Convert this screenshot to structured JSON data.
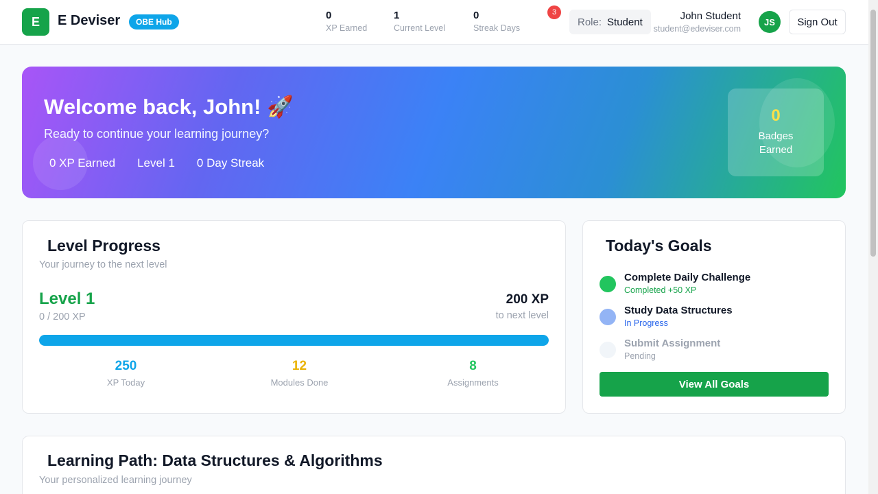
{
  "header": {
    "logo_letter": "E",
    "app_title": "E Deviser",
    "hub_badge": "OBE Hub",
    "stats": [
      {
        "value": "0",
        "label": "XP Earned"
      },
      {
        "value": "1",
        "label": "Current Level"
      },
      {
        "value": "0",
        "label": "Streak Days"
      }
    ],
    "notification_count": "3",
    "role_label": "Role:",
    "role_value": "Student",
    "user_name": "John Student",
    "user_email": "student@edeviser.com",
    "avatar_initials": "JS",
    "signout_label": "Sign Out"
  },
  "hero": {
    "title": "Welcome back, John! 🚀",
    "subtitle": "Ready to continue your learning journey?",
    "stats": [
      "0 XP Earned",
      "Level 1",
      "0 Day Streak"
    ],
    "badges_value": "0",
    "badges_label": "Badges Earned"
  },
  "level_progress": {
    "title": "Level Progress",
    "subtitle": "Your journey to the next level",
    "level": "Level 1",
    "xp_progress": "0 / 200 XP",
    "xp_needed": "200 XP",
    "xp_needed_label": "to next level",
    "progress_percent": 100,
    "mini_stats": [
      {
        "value": "250",
        "label": "XP Today",
        "color": "#0ea5e9"
      },
      {
        "value": "12",
        "label": "Modules Done",
        "color": "#eab308"
      },
      {
        "value": "8",
        "label": "Assignments",
        "color": "#22c55e"
      }
    ]
  },
  "goals": {
    "title": "Today's Goals",
    "items": [
      {
        "title": "Complete Daily Challenge",
        "status": "Completed +50 XP",
        "dot_color": "#22c55e",
        "status_color": "#16a34a",
        "title_color": "#111827"
      },
      {
        "title": "Study Data Structures",
        "status": "In Progress",
        "dot_color": "#93b4f5",
        "status_color": "#2563eb",
        "title_color": "#111827"
      },
      {
        "title": "Submit Assignment",
        "status": "Pending",
        "dot_color": "#f1f5f9",
        "status_color": "#9ca3af",
        "title_color": "#9ca3af"
      }
    ],
    "button_label": "View All Goals"
  },
  "learning_path": {
    "title": "Learning Path: Data Structures & Algorithms",
    "subtitle": "Your personalized learning journey"
  },
  "colors": {
    "primary_green": "#16a34a",
    "accent_blue": "#0ea5e9",
    "badge_yellow": "#fde047"
  }
}
